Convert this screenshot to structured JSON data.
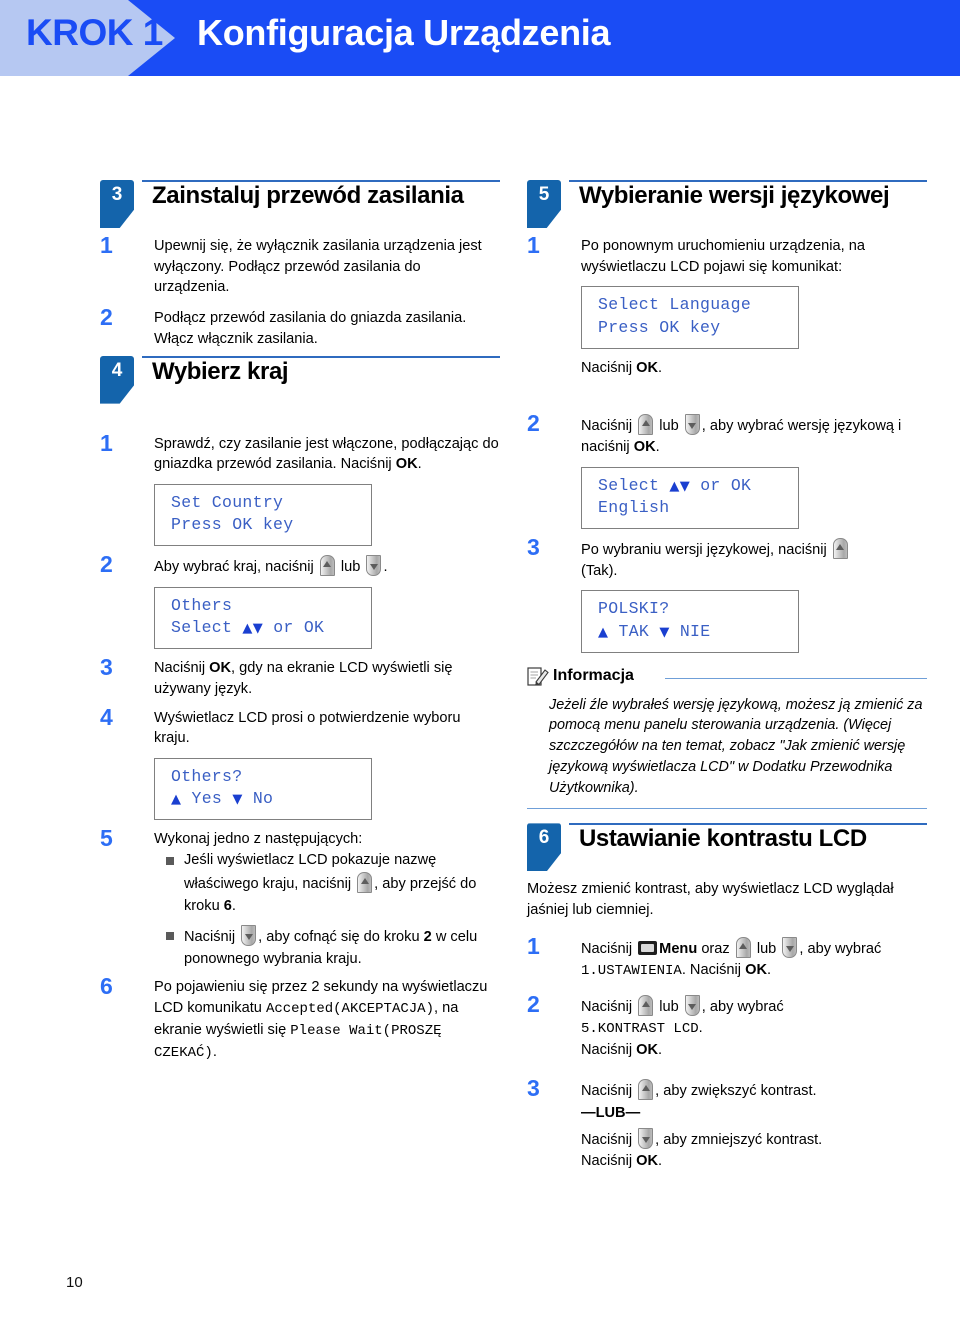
{
  "banner": {
    "step_label": "KROK 1",
    "title": "Konfiguracja Urządzenia",
    "arrow_color": "#b6c8f2",
    "bg_color": "#1a4cf5"
  },
  "footer": {
    "page_number": "10"
  },
  "colors": {
    "accent_blue": "#1a4cf5",
    "badge_blue": "#1464ab",
    "rule_blue": "#2f6bbf",
    "lcd_text": "#3a5fc4",
    "step_number": "#2d6ef5"
  },
  "left_column": {
    "section_3": {
      "number": "3",
      "title": "Zainstaluj przewód zasilania",
      "steps": [
        {
          "number": "1",
          "text": "Upewnij się, że wyłącznik zasilania urządzenia jest wyłączony. Podłącz przewód zasilania do urządzenia."
        },
        {
          "number": "2",
          "text": "Podłącz przewód zasilania do gniazda zasilania. Włącz włącznik zasilania."
        }
      ]
    },
    "section_4": {
      "number": "4",
      "title": "Wybierz kraj",
      "step1": {
        "number": "1",
        "text_before": "Sprawdź, czy zasilanie jest włączone, podłączając do gniazdka przewód zasilania. Naciśnij ",
        "ok": "OK",
        "text_after": ".",
        "lcd": {
          "line1": "Set Country",
          "line2": "Press OK key"
        }
      },
      "step2": {
        "number": "2",
        "text_before": "Aby wybrać kraj, naciśnij ",
        "or": " lub ",
        "text_after": ".",
        "lcd": {
          "line1": "Others",
          "line2_before": "Select ",
          "line2_arrows": "▲▼",
          "line2_after": " or OK"
        }
      },
      "step3": {
        "number": "3",
        "text_before": "Naciśnij ",
        "ok": "OK",
        "text_after": ", gdy na ekranie LCD wyświetli się używany język."
      },
      "step4": {
        "number": "4",
        "text": "Wyświetlacz LCD prosi o potwierdzenie wyboru kraju.",
        "lcd": {
          "line1": "Others?",
          "line2_up": "▲",
          "line2_yes": " Yes ",
          "line2_down": "▼",
          "line2_no": " No"
        }
      },
      "step5": {
        "number": "5",
        "intro": "Wykonaj jedno z następujących:",
        "bullet1_a": "Jeśli wyświetlacz LCD pokazuje nazwę właściwego kraju, naciśnij ",
        "bullet1_b": ", aby przejść do kroku ",
        "bullet1_step": "6",
        "bullet1_c": ".",
        "bullet2_a": "Naciśnij ",
        "bullet2_b": ", aby cofnąć się do kroku ",
        "bullet2_step": "2",
        "bullet2_c": " w celu ponownego wybrania kraju."
      },
      "step6": {
        "number": "6",
        "text_a": "Po pojawieniu się przez 2 sekundy na wyświetlaczu LCD komunikatu ",
        "mono1": "Accepted(AKCEPTACJA)",
        "text_b": ", na ekranie wyświetli się ",
        "mono2": "Please Wait(PROSZĘ CZEKAĆ)",
        "text_c": "."
      }
    }
  },
  "right_column": {
    "section_5": {
      "number": "5",
      "title": "Wybieranie wersji językowej",
      "step1": {
        "number": "1",
        "text": "Po ponownym uruchomieniu urządzenia, na wyświetlaczu LCD pojawi się komunikat:",
        "lcd": {
          "line1": "Select Language",
          "line2": "Press OK key"
        },
        "after_before": "Naciśnij ",
        "after_ok": "OK",
        "after_end": "."
      },
      "step2": {
        "number": "2",
        "text_before": "Naciśnij ",
        "or": " lub ",
        "text_mid": ", aby wybrać wersję językową i naciśnij ",
        "ok": "OK",
        "text_after": ".",
        "lcd": {
          "line1_before": "Select ",
          "line1_arrows": "▲▼",
          "line1_after": " or OK",
          "line2": "English"
        }
      },
      "step3": {
        "number": "3",
        "text_before": "Po wybraniu wersji językowej, naciśnij ",
        "text_after": "(Tak).",
        "lcd": {
          "line1": "POLSKI?",
          "line2_up": "▲",
          "line2_tak": " TAK ",
          "line2_down": "▼",
          "line2_nie": " NIE"
        }
      },
      "note": {
        "title": "Informacja",
        "icon": "notepad-pencil-icon",
        "body": "Jeżeli źle wybrałeś wersję językową, możesz ją zmienić za pomocą menu panelu sterowania urządzenia. (Więcej szczczegółów na ten temat, zobacz \"Jak zmienić wersję językową wyświetlacza LCD\" w Dodatku Przewodnika Użytkownika)."
      }
    },
    "section_6": {
      "number": "6",
      "title": "Ustawianie kontrastu LCD",
      "intro": "Możesz zmienić kontrast, aby wyświetlacz LCD wyglądał jaśniej lub ciemniej.",
      "step1": {
        "number": "1",
        "text_a": "Naciśnij ",
        "menu_label": "Menu",
        "text_b": " oraz ",
        "or": " lub ",
        "text_c": ", aby wybrać ",
        "mono": "1.USTAWIENIA",
        "text_d": ". Naciśnij ",
        "ok": "OK",
        "text_e": "."
      },
      "step2": {
        "number": "2",
        "text_a": "Naciśnij ",
        "or": " lub ",
        "text_b": ", aby wybrać ",
        "mono": "5.KONTRAST LCD",
        "text_c": ".",
        "text_d": "Naciśnij ",
        "ok": "OK",
        "text_e": "."
      },
      "step3": {
        "number": "3",
        "line1_a": "Naciśnij ",
        "line1_b": ", aby zwiększyć kontrast.",
        "lub": "—LUB—",
        "line2_a": "Naciśnij ",
        "line2_b": ", aby zmniejszyć kontrast.",
        "line3_a": "Naciśnij ",
        "ok": "OK",
        "line3_b": "."
      }
    }
  },
  "icons": {
    "key_up": "arrow-up-key-icon",
    "key_down": "arrow-down-key-icon",
    "menu": "menu-key-icon"
  }
}
